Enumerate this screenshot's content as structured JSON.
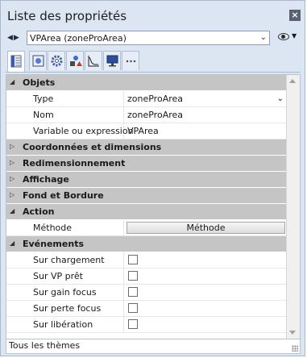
{
  "window": {
    "title": "Liste des propriétés"
  },
  "selector": {
    "value": "VPArea (zoneProArea)"
  },
  "tabs": [
    {
      "name": "properties-list-icon"
    },
    {
      "name": "object-icon"
    },
    {
      "name": "gear-icon"
    },
    {
      "name": "shapes-icon"
    },
    {
      "name": "chart-icon"
    },
    {
      "name": "monitor-icon"
    },
    {
      "name": "more-icon"
    }
  ],
  "grid": {
    "sections": {
      "objets": "Objets",
      "coordonnees": "Coordonnées et dimensions",
      "redimensionnement": "Redimensionnement",
      "affichage": "Affichage",
      "fond": "Fond et Bordure",
      "action": "Action",
      "evenements": "Evénements"
    },
    "objets": {
      "type_label": "Type",
      "type_value": "zoneProArea",
      "nom_label": "Nom",
      "nom_value": "zoneProArea",
      "var_label": "Variable ou expression",
      "var_value": "VPArea"
    },
    "action": {
      "methode_label": "Méthode",
      "methode_button": "Méthode"
    },
    "evenements": [
      {
        "label": "Sur chargement",
        "checked": false
      },
      {
        "label": "Sur VP prêt",
        "checked": false
      },
      {
        "label": "Sur gain focus",
        "checked": false
      },
      {
        "label": "Sur perte focus",
        "checked": false
      },
      {
        "label": "Sur libération",
        "checked": false
      }
    ]
  },
  "status": {
    "text": "Tous les thèmes"
  }
}
